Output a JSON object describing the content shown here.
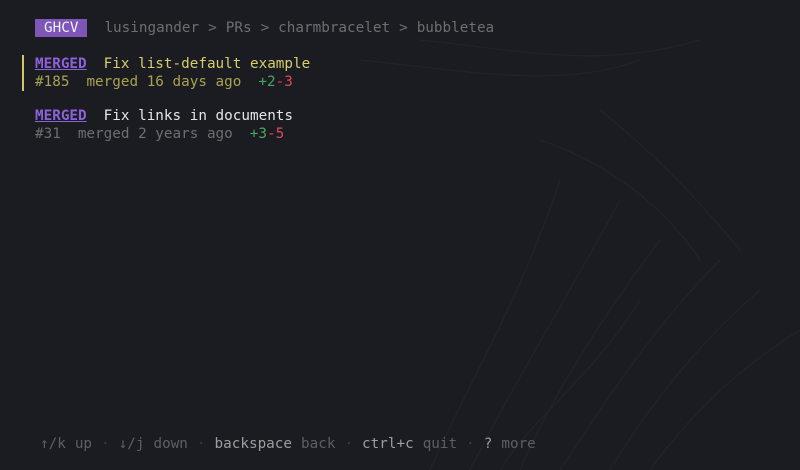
{
  "header": {
    "app_name": "GHCV",
    "breadcrumb": [
      "lusingander",
      "PRs",
      "charmbracelet",
      "bubbletea"
    ],
    "separator": ">"
  },
  "pull_requests": [
    {
      "state": "MERGED",
      "title": "Fix list-default example",
      "number": "#185",
      "merged_text": "merged 16 days ago",
      "additions": "+2",
      "deletions": "-3",
      "selected": true
    },
    {
      "state": "MERGED",
      "title": "Fix links in documents",
      "number": "#31",
      "merged_text": "merged 2 years ago",
      "additions": "+3",
      "deletions": "-5",
      "selected": false
    }
  ],
  "footer": {
    "separator": "·",
    "hints": [
      {
        "key": "↑/k",
        "desc": "up"
      },
      {
        "key": "↓/j",
        "desc": "down"
      },
      {
        "key": "backspace",
        "desc": "back"
      },
      {
        "key": "ctrl+c",
        "desc": "quit"
      },
      {
        "key": "?",
        "desc": "more"
      }
    ]
  },
  "colors": {
    "background": "#1b1c21",
    "accent_purple": "#7d56b8",
    "merged": "#8b62d9",
    "selected_yellow": "#d6cd6e",
    "addition_green": "#46a85c",
    "deletion_red": "#dc4a55"
  }
}
